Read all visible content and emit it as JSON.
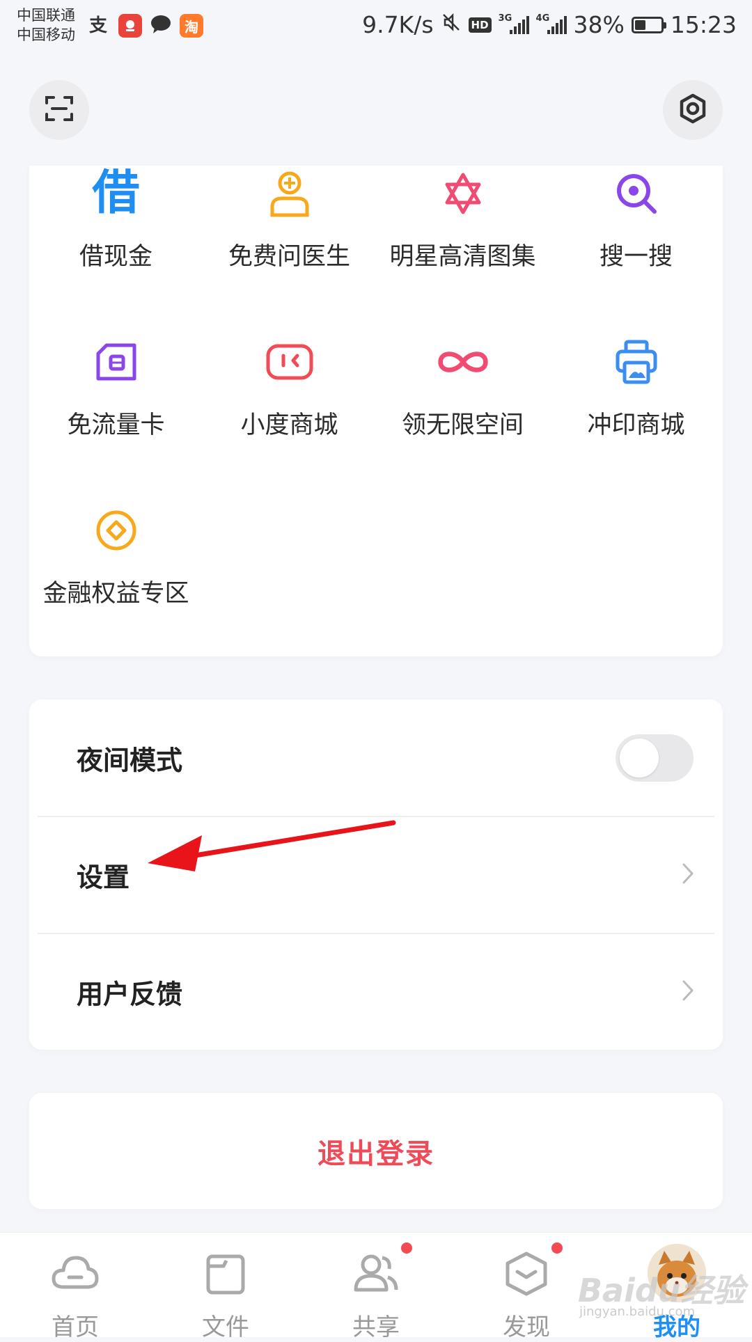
{
  "status_bar": {
    "carrier1": "中国联通",
    "carrier2": "中国移动",
    "net_speed": "9.7K/s",
    "hd": "HD",
    "sig1_label": "3G",
    "sig2_label": "4G",
    "battery": "38%",
    "time": "15:23",
    "app_icons": [
      "alipay-icon",
      "jd-icon",
      "message-icon",
      "taobao-icon"
    ],
    "taobao_char": "淘"
  },
  "header": {
    "scan_icon": "scan-icon",
    "settings_icon": "hexagon-settings-icon"
  },
  "grid": {
    "items": [
      {
        "label": "借现金",
        "icon": "borrow-icon",
        "glyph": "借",
        "color": "#1e8ef2"
      },
      {
        "label": "免费问医生",
        "icon": "doctor-icon",
        "color": "#f7a81b"
      },
      {
        "label": "明星高清图集",
        "icon": "star-gallery-icon",
        "color": "#f04b73"
      },
      {
        "label": "搜一搜",
        "icon": "search-icon",
        "color": "#8a46e8"
      },
      {
        "label": "免流量卡",
        "icon": "sim-card-icon",
        "color": "#8a46e8"
      },
      {
        "label": "小度商城",
        "icon": "xiaodu-shop-icon",
        "color": "#f04b57"
      },
      {
        "label": "领无限空间",
        "icon": "infinity-icon",
        "color": "#f04b73"
      },
      {
        "label": "冲印商城",
        "icon": "printer-icon",
        "color": "#3a8ef0"
      },
      {
        "label": "金融权益专区",
        "icon": "coin-icon",
        "color": "#f7a81b"
      }
    ]
  },
  "menu": {
    "night_mode": "夜间模式",
    "night_mode_on": false,
    "settings": "设置",
    "feedback": "用户反馈"
  },
  "logout": "退出登录",
  "bottom_nav": {
    "items": [
      {
        "label": "首页",
        "icon": "cloud-home-icon"
      },
      {
        "label": "文件",
        "icon": "folder-icon"
      },
      {
        "label": "共享",
        "icon": "share-people-icon"
      },
      {
        "label": "发现",
        "icon": "discover-box-icon"
      },
      {
        "label": "我的",
        "icon": "avatar"
      }
    ],
    "active": "我的"
  },
  "colors": {
    "accent": "#1e90f5",
    "danger": "#ef4a57",
    "badge": "#f24b54",
    "annotation_arrow": "#e8141a"
  },
  "watermark": {
    "main": "Baidu经验",
    "sub": "jingyan.baidu.com"
  }
}
